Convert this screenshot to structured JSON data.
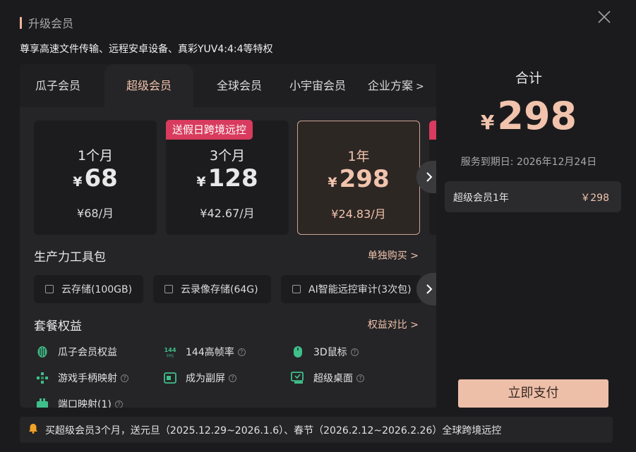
{
  "dialog": {
    "title": "升级会员",
    "subtitle": "尊享高速文件传输、远程安卓设备、真彩YUV4:4:4等特权"
  },
  "tabs": [
    {
      "label": "瓜子会员",
      "active": false
    },
    {
      "label": "超级会员",
      "active": true
    },
    {
      "label": "全球会员",
      "active": false
    },
    {
      "label": "小宇宙会员",
      "active": false
    },
    {
      "label": "企业方案",
      "arrow": ">",
      "active": false
    }
  ],
  "plans": [
    {
      "duration": "1个月",
      "currency": "¥",
      "price": "68",
      "monthly": "¥68/月",
      "badge": "",
      "selected": false
    },
    {
      "duration": "3个月",
      "currency": "¥",
      "price": "128",
      "monthly": "¥42.67/月",
      "badge": "送假日跨境远控",
      "selected": false
    },
    {
      "duration": "1年",
      "currency": "¥",
      "price": "298",
      "monthly": "¥24.83/月",
      "badge": "",
      "selected": true
    }
  ],
  "toolkit": {
    "title": "生产力工具包",
    "link": "单独购买 >",
    "items": [
      {
        "label": "云存储(100GB)",
        "checked": false
      },
      {
        "label": "云录像存储(64G)",
        "checked": false
      },
      {
        "label": "AI智能远控审计(3次包)",
        "checked": false
      }
    ]
  },
  "benefits": {
    "title": "套餐权益",
    "link": "权益对比 >",
    "items": [
      {
        "label": "瓜子会员权益",
        "icon": "melon-seed-icon",
        "help": false
      },
      {
        "label": "144高帧率",
        "icon": "144fps-icon",
        "icon_text": "144",
        "icon_subtext": "FPS",
        "help": true
      },
      {
        "label": "3D鼠标",
        "icon": "mouse-icon",
        "help": true
      },
      {
        "label": "游戏手柄映射",
        "icon": "gamepad-icon",
        "help": true
      },
      {
        "label": "成为副屏",
        "icon": "second-screen-icon",
        "help": true
      },
      {
        "label": "超级桌面",
        "icon": "super-desktop-icon",
        "help": true
      },
      {
        "label": "端口映射(1)",
        "icon": "port-mapping-icon",
        "help": true
      }
    ],
    "help_glyph": "?"
  },
  "summary": {
    "total_label": "合计",
    "currency": "¥",
    "total": "298",
    "expire": "服务到期日: 2026年12月24日",
    "line_item": "超级会员1年",
    "line_amount": "￥298",
    "pay_button": "立即支付"
  },
  "notice": {
    "text": "买超级会员3个月，送元旦（2025.12.29~2026.1.6）、春节（2026.2.12~2026.2.26）全球跨境远控"
  },
  "colors": {
    "accent": "#f1c3ad",
    "badge": "#d83b5d",
    "icon_green": "#3fbf8a",
    "background": "#1b1b1d"
  }
}
